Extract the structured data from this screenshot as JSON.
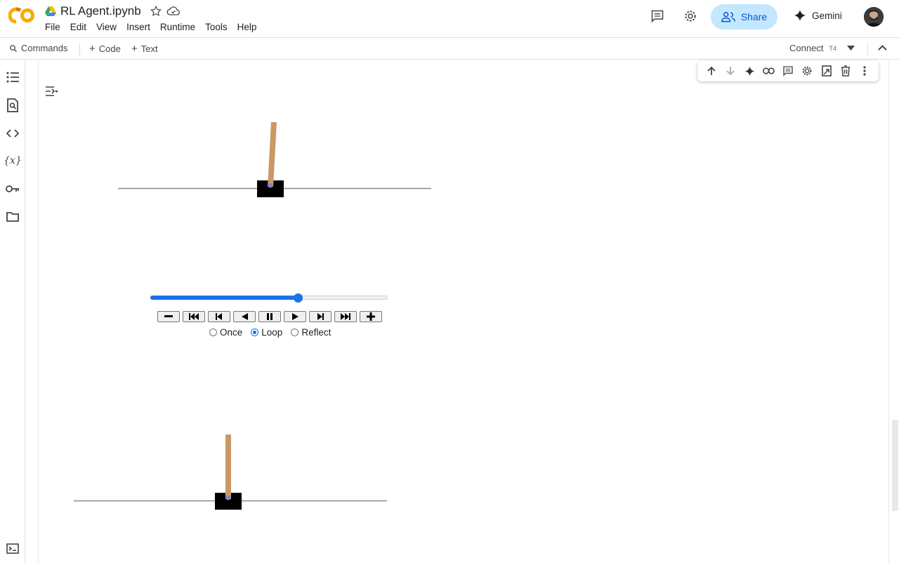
{
  "header": {
    "notebook_title": "RL Agent.ipynb",
    "menu": [
      "File",
      "Edit",
      "View",
      "Insert",
      "Runtime",
      "Tools",
      "Help"
    ],
    "share_label": "Share",
    "gemini_label": "Gemini",
    "brand_color": "#f9ab00",
    "share_bg": "#c2e7ff"
  },
  "toolbar": {
    "commands_label": "Commands",
    "code_label": "Code",
    "text_label": "Text",
    "connect_label": "Connect",
    "runtime_badge": "T4"
  },
  "left_rail": [
    "table-of-contents-icon",
    "find-icon",
    "code-snippets-icon",
    "variables-icon",
    "secrets-key-icon",
    "files-folder-icon",
    "terminal-icon"
  ],
  "cell_toolbar": [
    "move-up-icon",
    "move-down-icon",
    "gemini-spark-icon",
    "link-icon",
    "comment-icon",
    "settings-icon",
    "mirror-cell-icon",
    "delete-icon",
    "more-vert-icon"
  ],
  "animation": {
    "progress": 0.62,
    "buttons": [
      "minus",
      "first",
      "prev-frame",
      "play-reverse",
      "pause",
      "play",
      "next-frame",
      "last",
      "plus"
    ],
    "modes": [
      "Once",
      "Loop",
      "Reflect"
    ],
    "selected_mode": "Loop",
    "slider_color": "#1a73e8",
    "pole_color": "#ca9865",
    "axle_color": "#8184cb"
  }
}
